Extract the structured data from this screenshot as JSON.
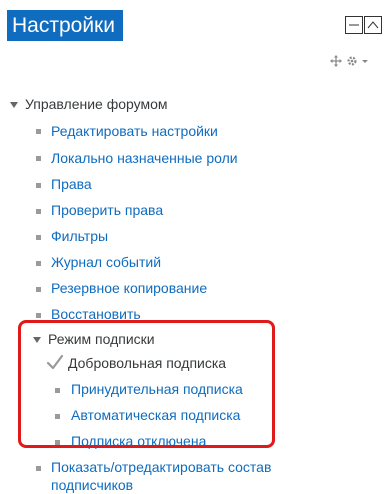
{
  "block": {
    "title": "Настройки"
  },
  "tree": {
    "root_label": "Управление форумом",
    "items": [
      {
        "label": "Редактировать настройки"
      },
      {
        "label": "Локально назначенные роли"
      },
      {
        "label": "Права"
      },
      {
        "label": "Проверить права"
      },
      {
        "label": "Фильтры"
      },
      {
        "label": "Журнал событий"
      },
      {
        "label": "Резервное копирование"
      },
      {
        "label": "Восстановить"
      }
    ],
    "subscription": {
      "label": "Режим подписки",
      "options": [
        {
          "label": "Добровольная подписка",
          "selected": true
        },
        {
          "label": "Принудительная подписка",
          "selected": false
        },
        {
          "label": "Автоматическая подписка",
          "selected": false
        },
        {
          "label": "Подписка отключена",
          "selected": false
        }
      ]
    },
    "subscribers_label_line1": "Показать/отредактировать состав",
    "subscribers_label_line2": "подписчиков"
  },
  "colors": {
    "accent": "#0f6cbf",
    "highlight": "#e01a1a",
    "text": "#373a3c"
  }
}
